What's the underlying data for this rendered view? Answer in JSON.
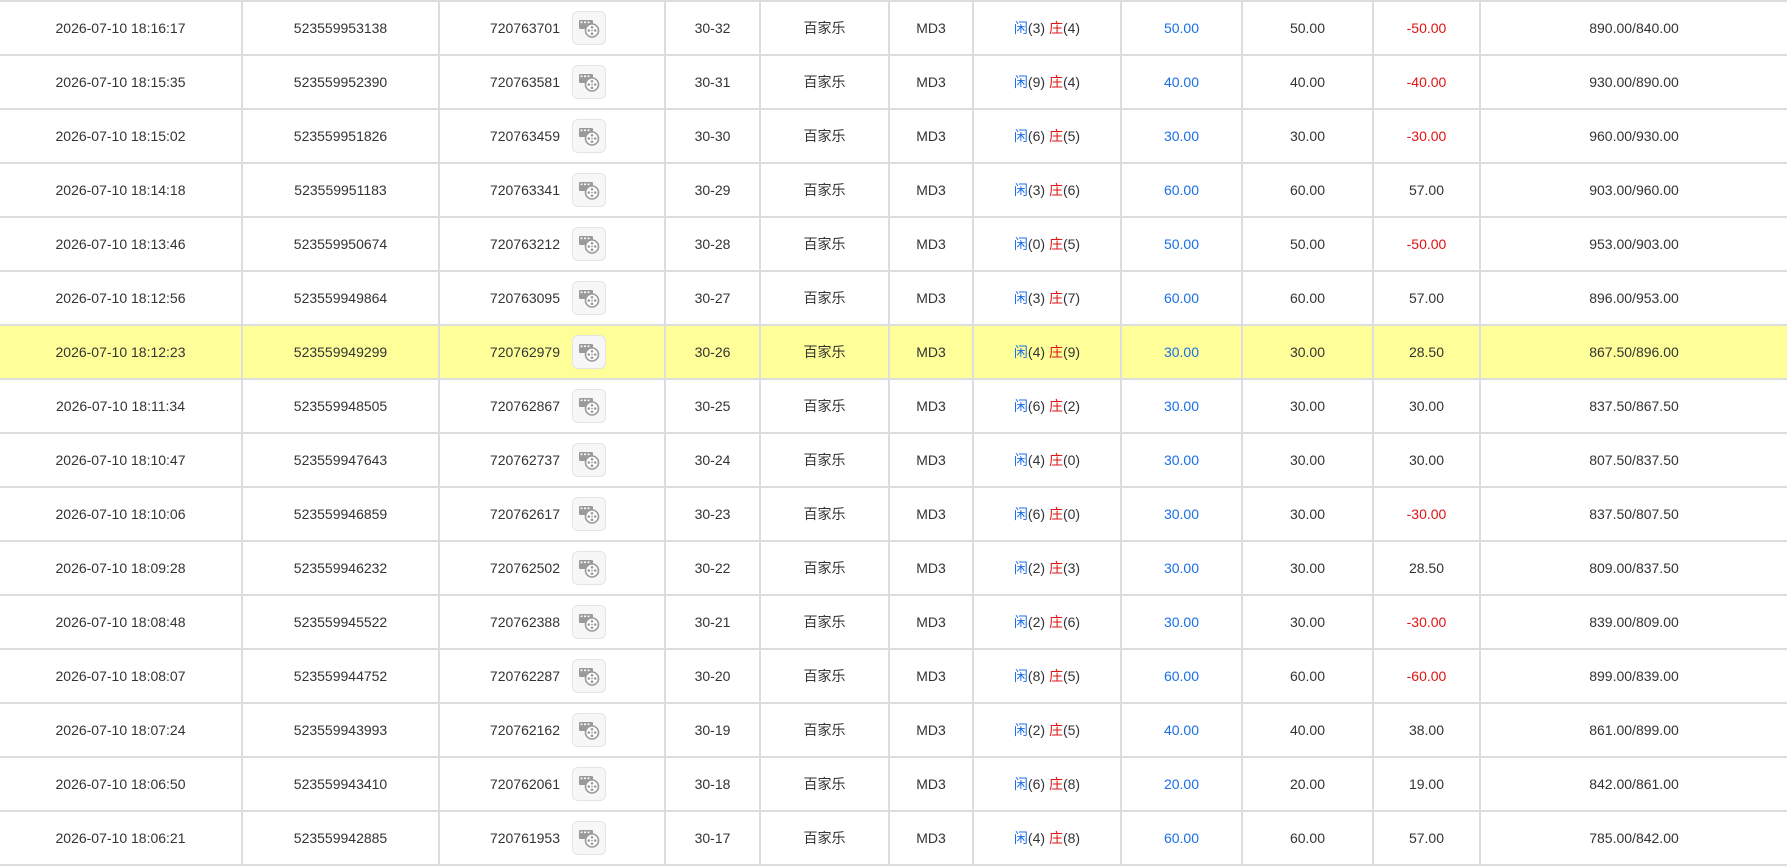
{
  "table": {
    "player_label": "闲",
    "banker_label": "庄",
    "rows": [
      {
        "time": "2026-07-10 18:16:17",
        "order_id": "523559953138",
        "round_id": "720763701",
        "shoe": "30-32",
        "game": "百家乐",
        "table": "MD3",
        "player_pts": "(3)",
        "banker_pts": "(4)",
        "bet": "50.00",
        "valid_bet": "50.00",
        "win_loss": "-50.00",
        "balance": "890.00/840.00",
        "neg": true,
        "highlight": false
      },
      {
        "time": "2026-07-10 18:15:35",
        "order_id": "523559952390",
        "round_id": "720763581",
        "shoe": "30-31",
        "game": "百家乐",
        "table": "MD3",
        "player_pts": "(9)",
        "banker_pts": "(4)",
        "bet": "40.00",
        "valid_bet": "40.00",
        "win_loss": "-40.00",
        "balance": "930.00/890.00",
        "neg": true,
        "highlight": false
      },
      {
        "time": "2026-07-10 18:15:02",
        "order_id": "523559951826",
        "round_id": "720763459",
        "shoe": "30-30",
        "game": "百家乐",
        "table": "MD3",
        "player_pts": "(6)",
        "banker_pts": "(5)",
        "bet": "30.00",
        "valid_bet": "30.00",
        "win_loss": "-30.00",
        "balance": "960.00/930.00",
        "neg": true,
        "highlight": false
      },
      {
        "time": "2026-07-10 18:14:18",
        "order_id": "523559951183",
        "round_id": "720763341",
        "shoe": "30-29",
        "game": "百家乐",
        "table": "MD3",
        "player_pts": "(3)",
        "banker_pts": "(6)",
        "bet": "60.00",
        "valid_bet": "60.00",
        "win_loss": "57.00",
        "balance": "903.00/960.00",
        "neg": false,
        "highlight": false
      },
      {
        "time": "2026-07-10 18:13:46",
        "order_id": "523559950674",
        "round_id": "720763212",
        "shoe": "30-28",
        "game": "百家乐",
        "table": "MD3",
        "player_pts": "(0)",
        "banker_pts": "(5)",
        "bet": "50.00",
        "valid_bet": "50.00",
        "win_loss": "-50.00",
        "balance": "953.00/903.00",
        "neg": true,
        "highlight": false
      },
      {
        "time": "2026-07-10 18:12:56",
        "order_id": "523559949864",
        "round_id": "720763095",
        "shoe": "30-27",
        "game": "百家乐",
        "table": "MD3",
        "player_pts": "(3)",
        "banker_pts": "(7)",
        "bet": "60.00",
        "valid_bet": "60.00",
        "win_loss": "57.00",
        "balance": "896.00/953.00",
        "neg": false,
        "highlight": false
      },
      {
        "time": "2026-07-10 18:12:23",
        "order_id": "523559949299",
        "round_id": "720762979",
        "shoe": "30-26",
        "game": "百家乐",
        "table": "MD3",
        "player_pts": "(4)",
        "banker_pts": "(9)",
        "bet": "30.00",
        "valid_bet": "30.00",
        "win_loss": "28.50",
        "balance": "867.50/896.00",
        "neg": false,
        "highlight": true
      },
      {
        "time": "2026-07-10 18:11:34",
        "order_id": "523559948505",
        "round_id": "720762867",
        "shoe": "30-25",
        "game": "百家乐",
        "table": "MD3",
        "player_pts": "(6)",
        "banker_pts": "(2)",
        "bet": "30.00",
        "valid_bet": "30.00",
        "win_loss": "30.00",
        "balance": "837.50/867.50",
        "neg": false,
        "highlight": false
      },
      {
        "time": "2026-07-10 18:10:47",
        "order_id": "523559947643",
        "round_id": "720762737",
        "shoe": "30-24",
        "game": "百家乐",
        "table": "MD3",
        "player_pts": "(4)",
        "banker_pts": "(0)",
        "bet": "30.00",
        "valid_bet": "30.00",
        "win_loss": "30.00",
        "balance": "807.50/837.50",
        "neg": false,
        "highlight": false
      },
      {
        "time": "2026-07-10 18:10:06",
        "order_id": "523559946859",
        "round_id": "720762617",
        "shoe": "30-23",
        "game": "百家乐",
        "table": "MD3",
        "player_pts": "(6)",
        "banker_pts": "(0)",
        "bet": "30.00",
        "valid_bet": "30.00",
        "win_loss": "-30.00",
        "balance": "837.50/807.50",
        "neg": true,
        "highlight": false
      },
      {
        "time": "2026-07-10 18:09:28",
        "order_id": "523559946232",
        "round_id": "720762502",
        "shoe": "30-22",
        "game": "百家乐",
        "table": "MD3",
        "player_pts": "(2)",
        "banker_pts": "(3)",
        "bet": "30.00",
        "valid_bet": "30.00",
        "win_loss": "28.50",
        "balance": "809.00/837.50",
        "neg": false,
        "highlight": false
      },
      {
        "time": "2026-07-10 18:08:48",
        "order_id": "523559945522",
        "round_id": "720762388",
        "shoe": "30-21",
        "game": "百家乐",
        "table": "MD3",
        "player_pts": "(2)",
        "banker_pts": "(6)",
        "bet": "30.00",
        "valid_bet": "30.00",
        "win_loss": "-30.00",
        "balance": "839.00/809.00",
        "neg": true,
        "highlight": false
      },
      {
        "time": "2026-07-10 18:08:07",
        "order_id": "523559944752",
        "round_id": "720762287",
        "shoe": "30-20",
        "game": "百家乐",
        "table": "MD3",
        "player_pts": "(8)",
        "banker_pts": "(5)",
        "bet": "60.00",
        "valid_bet": "60.00",
        "win_loss": "-60.00",
        "balance": "899.00/839.00",
        "neg": true,
        "highlight": false
      },
      {
        "time": "2026-07-10 18:07:24",
        "order_id": "523559943993",
        "round_id": "720762162",
        "shoe": "30-19",
        "game": "百家乐",
        "table": "MD3",
        "player_pts": "(2)",
        "banker_pts": "(5)",
        "bet": "40.00",
        "valid_bet": "40.00",
        "win_loss": "38.00",
        "balance": "861.00/899.00",
        "neg": false,
        "highlight": false
      },
      {
        "time": "2026-07-10 18:06:50",
        "order_id": "523559943410",
        "round_id": "720762061",
        "shoe": "30-18",
        "game": "百家乐",
        "table": "MD3",
        "player_pts": "(6)",
        "banker_pts": "(8)",
        "bet": "20.00",
        "valid_bet": "20.00",
        "win_loss": "19.00",
        "balance": "842.00/861.00",
        "neg": false,
        "highlight": false
      },
      {
        "time": "2026-07-10 18:06:21",
        "order_id": "523559942885",
        "round_id": "720761953",
        "shoe": "30-17",
        "game": "百家乐",
        "table": "MD3",
        "player_pts": "(4)",
        "banker_pts": "(8)",
        "bet": "60.00",
        "valid_bet": "60.00",
        "win_loss": "57.00",
        "balance": "785.00/842.00",
        "neg": false,
        "highlight": false
      }
    ]
  },
  "colors": {
    "player": "#1a6fe8",
    "banker": "#e21313",
    "negative": "#e21313",
    "highlight_row": "#ffff99",
    "border": "#dddddd"
  },
  "icons": {
    "replay": "video-replay-icon"
  }
}
